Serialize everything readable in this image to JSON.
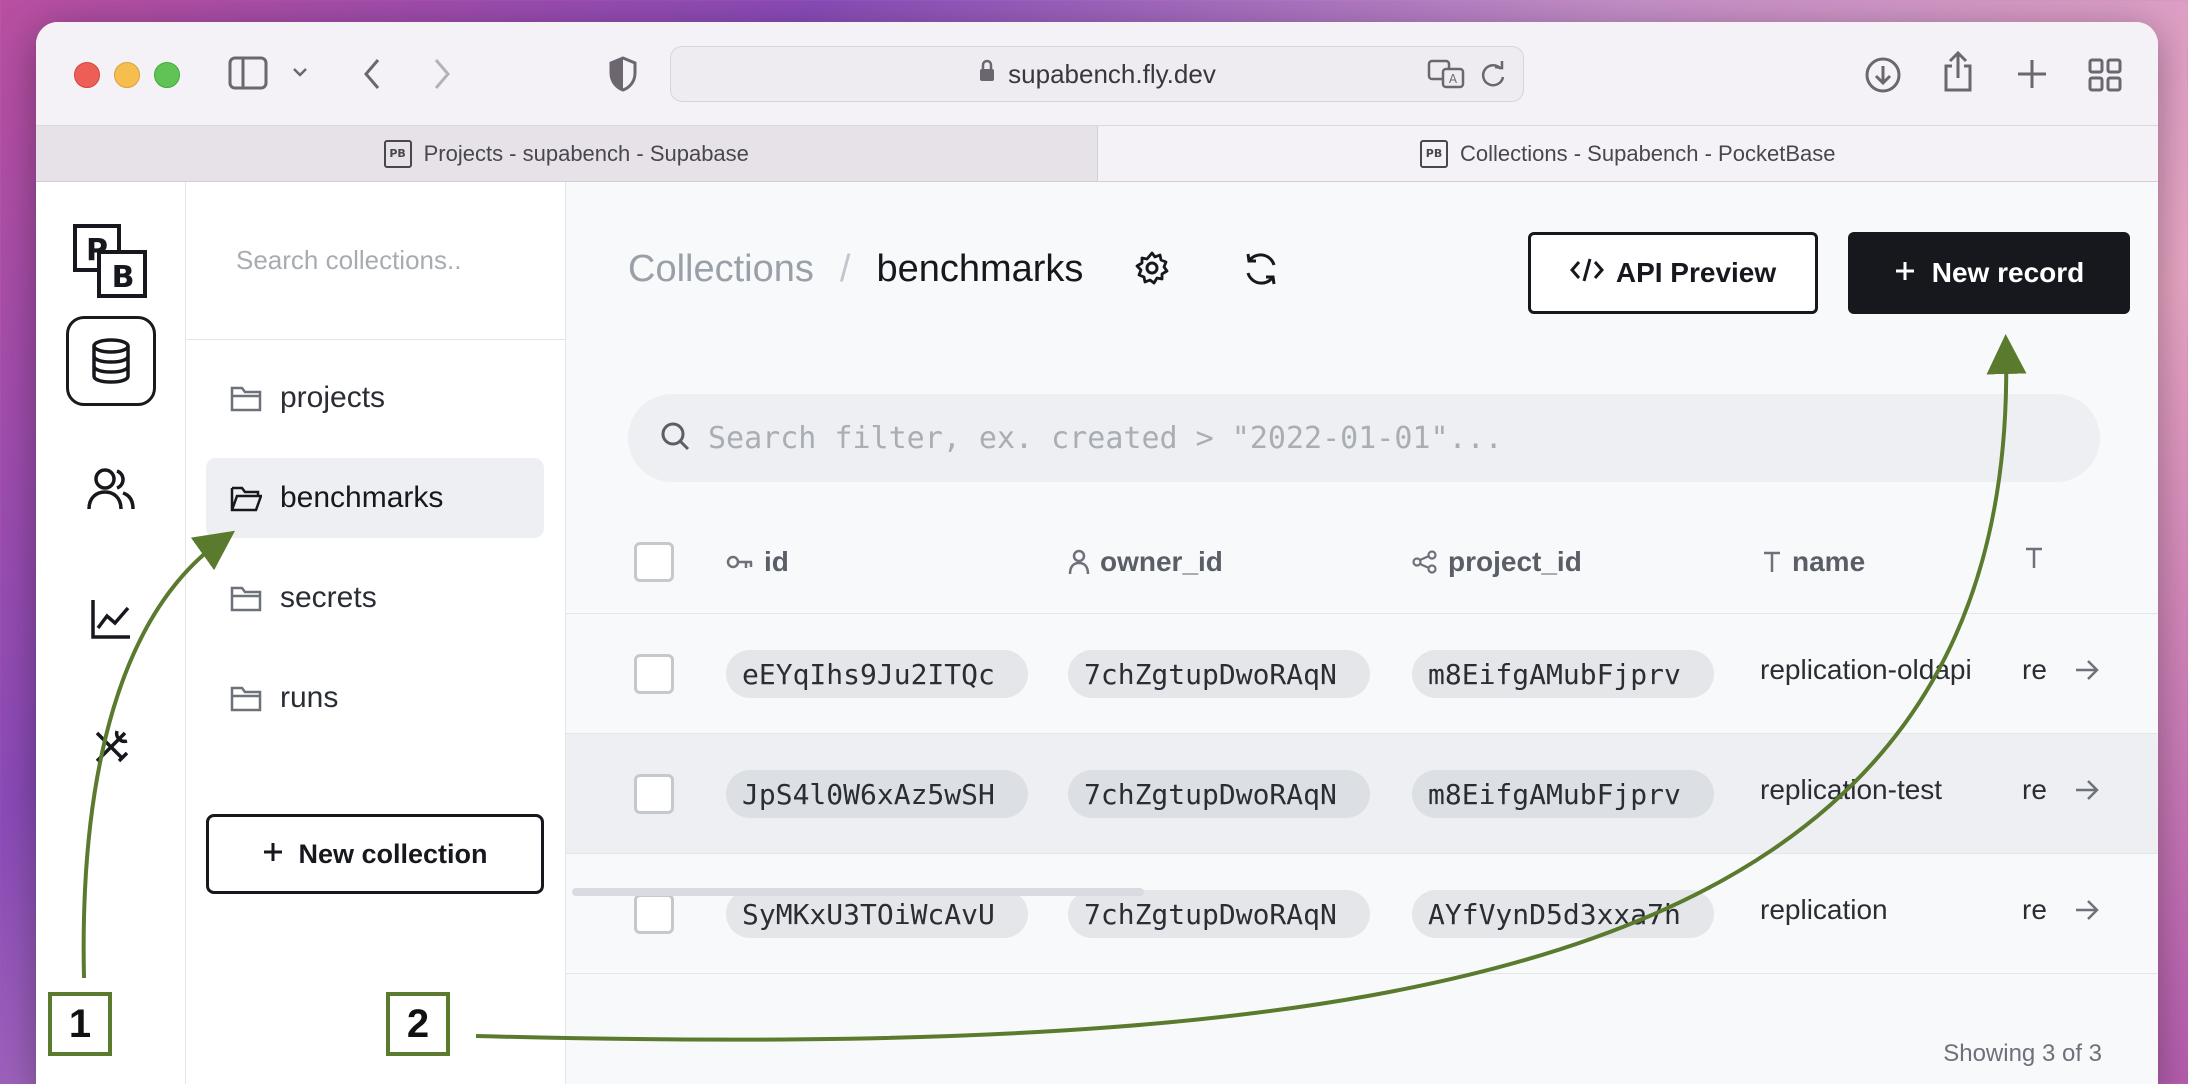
{
  "browser": {
    "url": "supabench.fly.dev",
    "tabs": [
      {
        "label": "Projects - supabench - Supabase",
        "favicon": "PB"
      },
      {
        "label": "Collections - Supabench - PocketBase",
        "favicon": "PB"
      }
    ]
  },
  "app": {
    "logo_text_top": "P",
    "logo_text_bottom": "B"
  },
  "sidebar": {
    "search_placeholder": "Search collections..",
    "collections": [
      {
        "label": "projects",
        "active": false
      },
      {
        "label": "benchmarks",
        "active": true
      },
      {
        "label": "secrets",
        "active": false
      },
      {
        "label": "runs",
        "active": false
      }
    ],
    "new_collection_label": "New collection"
  },
  "header": {
    "breadcrumb_root": "Collections",
    "breadcrumb_sep": "/",
    "breadcrumb_current": "benchmarks",
    "api_preview_label": "API Preview",
    "new_record_label": "New record"
  },
  "filter": {
    "placeholder": "Search filter, ex. created > \"2022-01-01\"..."
  },
  "table": {
    "columns": [
      "id",
      "owner_id",
      "project_id",
      "name",
      ""
    ],
    "rows": [
      {
        "id": "eEYqIhs9Ju2ITQc",
        "owner_id": "7chZgtupDwoRAqN",
        "project_id": "m8EifgAMubFjprv",
        "name": "replication-oldapi",
        "extra": "re"
      },
      {
        "id": "JpS4l0W6xAz5wSH",
        "owner_id": "7chZgtupDwoRAqN",
        "project_id": "m8EifgAMubFjprv",
        "name": "replication-test",
        "extra": "re"
      },
      {
        "id": "SyMKxU3TOiWcAvU",
        "owner_id": "7chZgtupDwoRAqN",
        "project_id": "AYfVynD5d3xxa7h",
        "name": "replication",
        "extra": "re"
      }
    ],
    "showing": "Showing 3 of 3"
  },
  "annotations": {
    "marker_1": "1",
    "marker_2": "2",
    "color": "#5a7a2e"
  }
}
